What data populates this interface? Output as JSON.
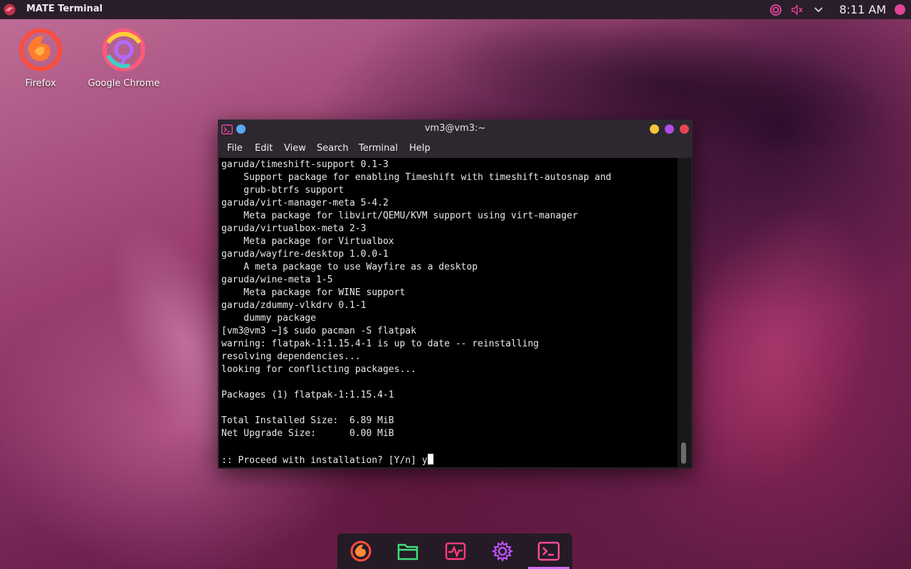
{
  "top_panel": {
    "app_title": "MATE Terminal",
    "clock": "8:11 AM"
  },
  "desktop_icons": [
    {
      "label": "Firefox",
      "icon": "firefox-icon"
    },
    {
      "label": "Google Chrome",
      "icon": "chrome-icon"
    }
  ],
  "terminal": {
    "title": "vm3@vm3:~",
    "menu": [
      "File",
      "Edit",
      "View",
      "Search",
      "Terminal",
      "Help"
    ],
    "lines": [
      "garuda/timeshift-support 0.1-3",
      "    Support package for enabling Timeshift with timeshift-autosnap and",
      "    grub-btrfs support",
      "garuda/virt-manager-meta 5-4.2",
      "    Meta package for libvirt/QEMU/KVM support using virt-manager",
      "garuda/virtualbox-meta 2-3",
      "    Meta package for Virtualbox",
      "garuda/wayfire-desktop 1.0.0-1",
      "    A meta package to use Wayfire as a desktop",
      "garuda/wine-meta 1-5",
      "    Meta package for WINE support",
      "garuda/zdummy-vlkdrv 0.1-1",
      "    dummy package",
      "[vm3@vm3 ~]$ sudo pacman -S flatpak",
      "warning: flatpak-1:1.15.4-1 is up to date -- reinstalling",
      "resolving dependencies...",
      "looking for conflicting packages...",
      "",
      "Packages (1) flatpak-1:1.15.4-1",
      "",
      "Total Installed Size:  6.89 MiB",
      "Net Upgrade Size:      0.00 MiB",
      ""
    ],
    "prompt_line": ":: Proceed with installation? [Y/n] ",
    "input_value": "y"
  },
  "dock": {
    "items": [
      {
        "icon": "firefox-icon"
      },
      {
        "icon": "files-icon"
      },
      {
        "icon": "system-monitor-icon"
      },
      {
        "icon": "settings-icon"
      },
      {
        "icon": "terminal-icon"
      }
    ]
  },
  "colors": {
    "panel": "#2a1e2a",
    "accent": "#d36cff",
    "window_close": "#e64553",
    "window_maximize": "#b04ce8",
    "window_minimize": "#f6c43c"
  }
}
